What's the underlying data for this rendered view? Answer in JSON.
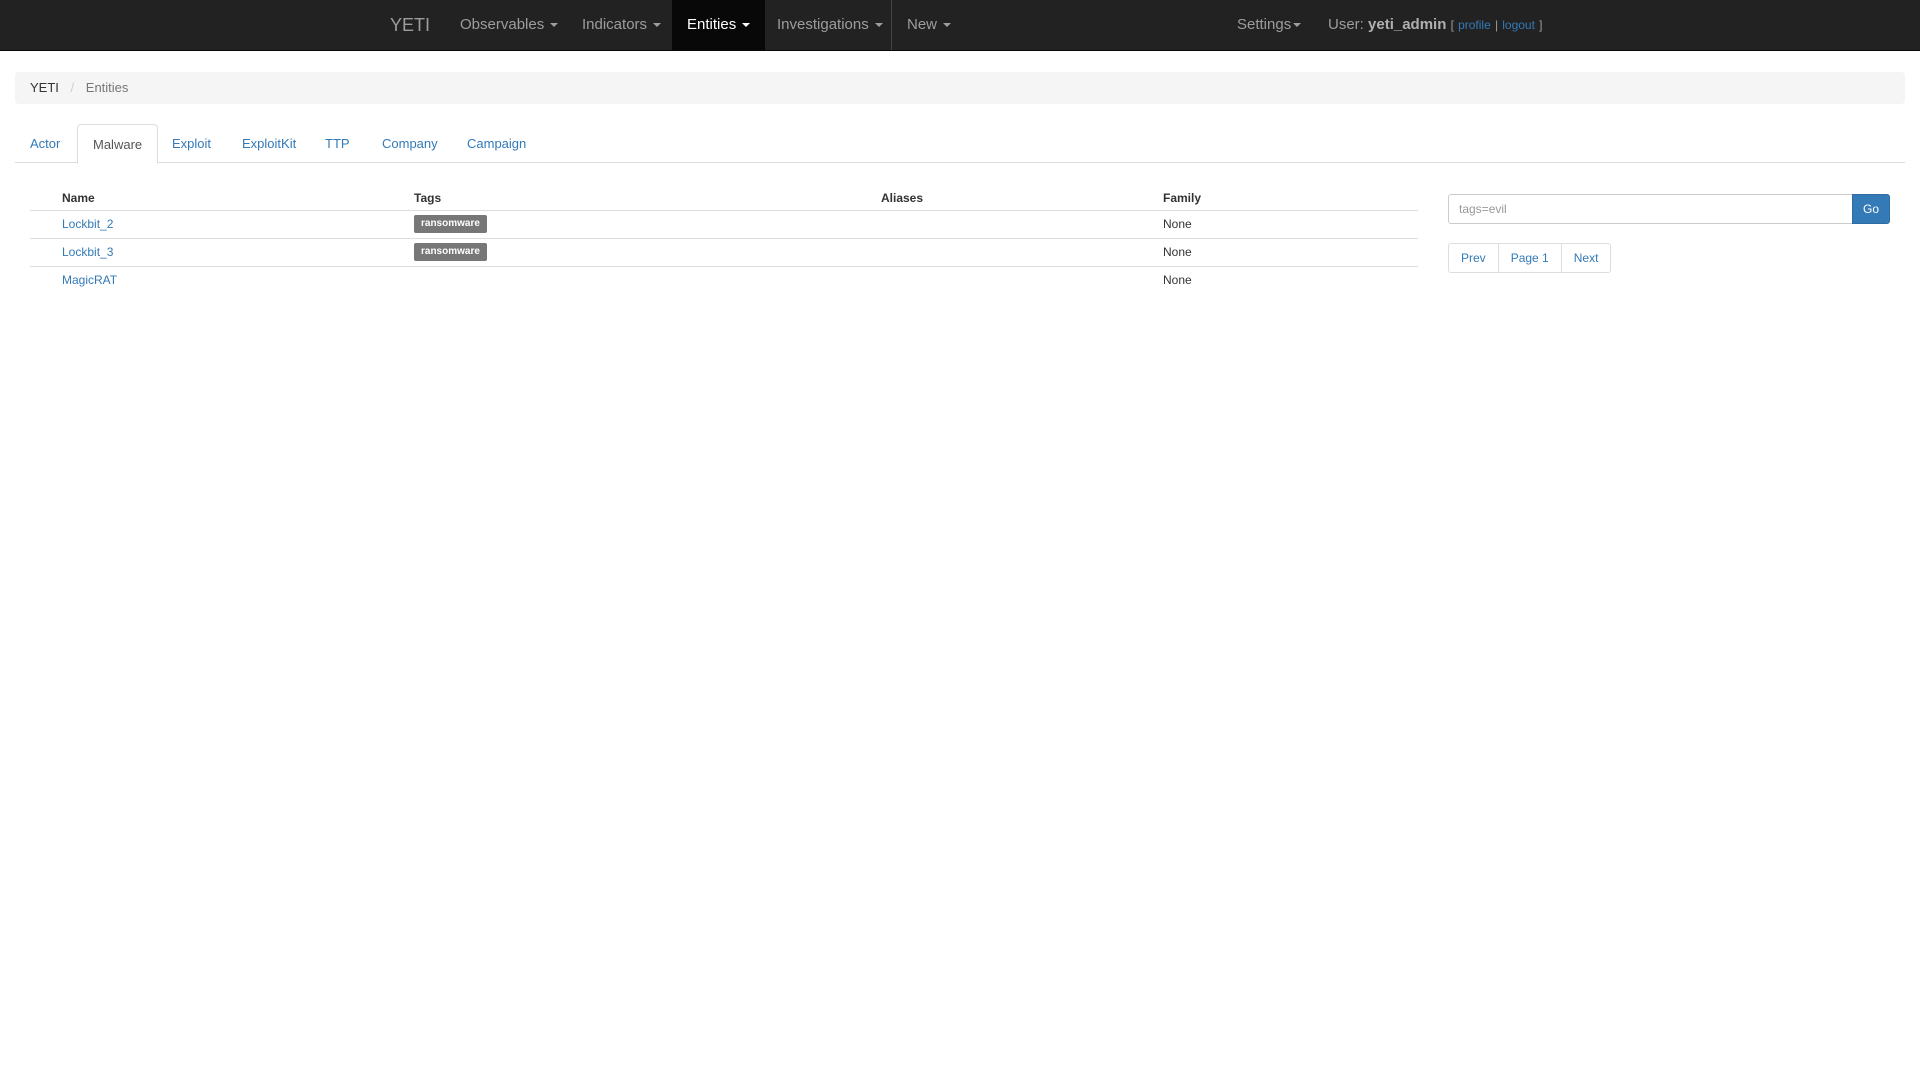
{
  "navbar": {
    "brand": "YETI",
    "items": [
      {
        "label": "Observables",
        "active": false
      },
      {
        "label": "Indicators",
        "active": false
      },
      {
        "label": "Entities",
        "active": true
      },
      {
        "label": "Investigations",
        "active": false
      },
      {
        "label": "New",
        "active": false
      }
    ],
    "settings_label": "Settings",
    "user_prefix": "User:",
    "username": "yeti_admin",
    "profile_label": "profile",
    "logout_label": "logout",
    "bracket_open": "[",
    "bracket_sep": "|",
    "bracket_close": "]"
  },
  "breadcrumb": {
    "home": "YETI",
    "separator": "/",
    "current": "Entities"
  },
  "tabs": [
    {
      "label": "Actor",
      "active": false
    },
    {
      "label": "Malware",
      "active": true
    },
    {
      "label": "Exploit",
      "active": false
    },
    {
      "label": "ExploitKit",
      "active": false
    },
    {
      "label": "TTP",
      "active": false
    },
    {
      "label": "Company",
      "active": false
    },
    {
      "label": "Campaign",
      "active": false
    }
  ],
  "table": {
    "headers": {
      "name": "Name",
      "tags": "Tags",
      "aliases": "Aliases",
      "family": "Family"
    },
    "rows": [
      {
        "name": "Lockbit_2",
        "tag": "ransomware",
        "aliases": "",
        "family": "None"
      },
      {
        "name": "Lockbit_3",
        "tag": "ransomware",
        "aliases": "",
        "family": "None"
      },
      {
        "name": "MagicRAT",
        "tag": "",
        "aliases": "",
        "family": "None"
      }
    ]
  },
  "search": {
    "placeholder": "tags=evil",
    "value": "",
    "go_label": "Go"
  },
  "pagination": {
    "prev": "Prev",
    "page": "Page 1",
    "next": "Next"
  },
  "colors": {
    "navbar_bg": "#222222",
    "link": "#337ab7",
    "tag_bg": "#777777",
    "primary_button": "#337ab7"
  }
}
